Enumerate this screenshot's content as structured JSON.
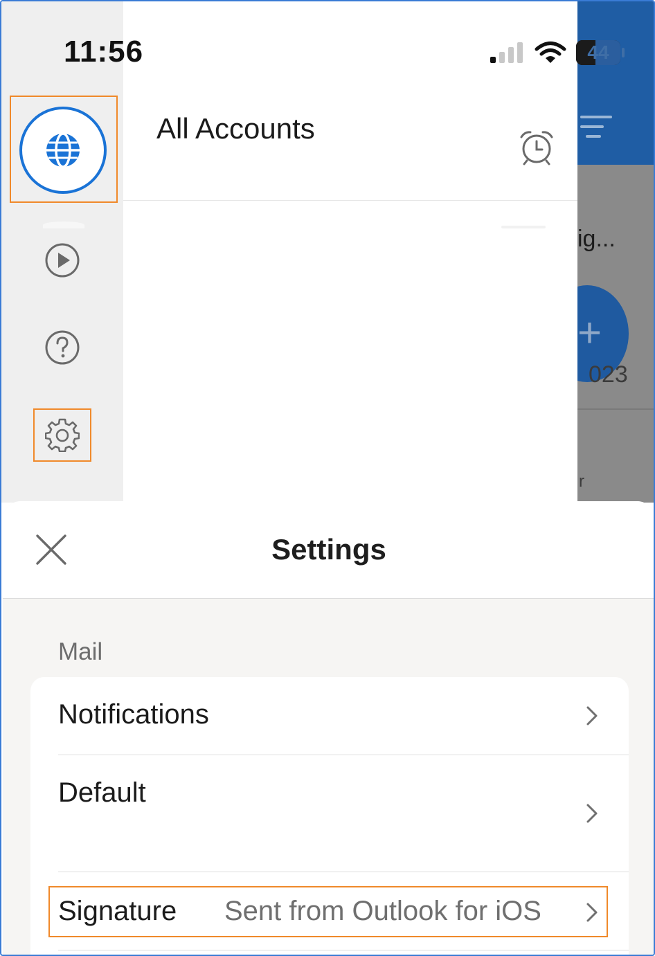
{
  "status_bar": {
    "time": "11:56",
    "battery": "44"
  },
  "background_app": {
    "preview_snippet": "ig...",
    "preview_date": "023",
    "preview_extra": "r"
  },
  "sidebar": {
    "items": [
      {
        "icon": "globe-icon",
        "state": "selected"
      },
      {
        "icon": "play-icon"
      },
      {
        "icon": "help-icon"
      },
      {
        "icon": "gear-icon"
      }
    ]
  },
  "drawer": {
    "title": "All Accounts",
    "alarm_icon": "alarm-clock-icon"
  },
  "settings": {
    "title": "Settings",
    "close_icon": "close-icon",
    "section_label": "Mail",
    "rows": [
      {
        "label": "Notifications",
        "value": ""
      },
      {
        "label": "Default",
        "value": ""
      },
      {
        "label": "Signature",
        "value": "Sent from Outlook for iOS"
      }
    ]
  },
  "colors": {
    "accent_blue": "#1a73d6",
    "header_blue": "#1f5da4",
    "highlight_orange": "#f0892a"
  }
}
